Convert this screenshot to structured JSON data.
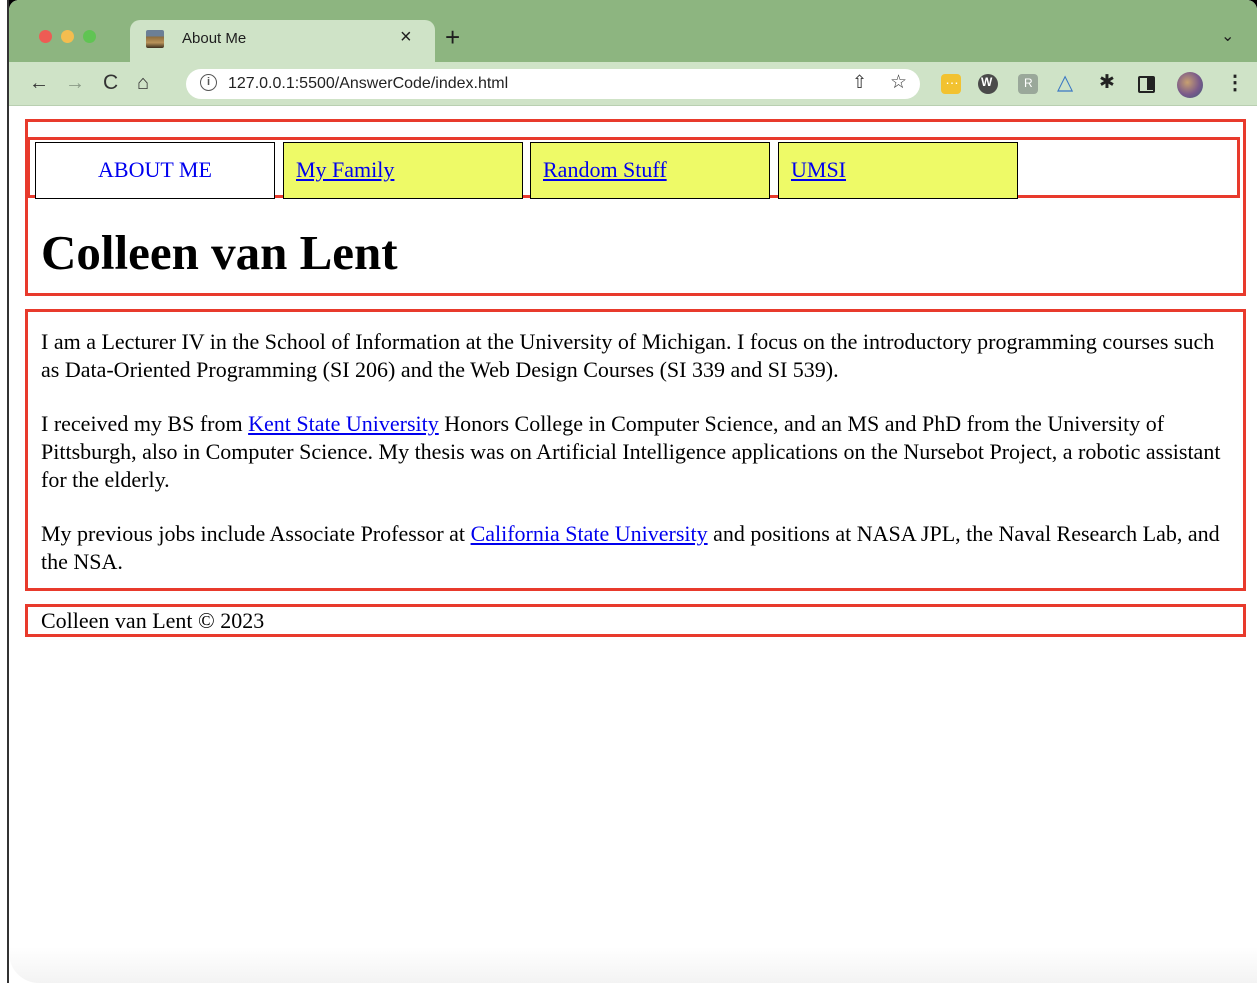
{
  "browser": {
    "tab": {
      "title": "About Me",
      "close": "×"
    },
    "new_tab": "+",
    "tab_menu": "⌄",
    "toolbar": {
      "back": "←",
      "forward": "→",
      "reload": "C",
      "home": "⌂",
      "info": "i",
      "url": "127.0.0.1:5500/AnswerCode/index.html",
      "share": "⇧",
      "bookmark": "☆",
      "menu": "⋮"
    },
    "extensions": [
      "extension-ellipsis-icon",
      "extension-w-icon",
      "extension-r-icon",
      "extension-triangle-icon",
      "puzzle-icon",
      "sidepanel-icon"
    ]
  },
  "page": {
    "nav": [
      {
        "label": "ABOUT ME",
        "active": true
      },
      {
        "label": "My Family",
        "active": false
      },
      {
        "label": "Random Stuff",
        "active": false
      },
      {
        "label": "UMSI",
        "active": false
      }
    ],
    "title": "Colleen van Lent",
    "paragraphs": {
      "p1": "I am a Lecturer IV in the School of Information at the University of Michigan. I focus on the introductory programming courses such as Data-Oriented Programming (SI 206) and the Web Design Courses (SI 339 and SI 539).",
      "p2_before": "I received my BS from ",
      "p2_link": "Kent State University",
      "p2_after": " Honors College in Computer Science, and an MS and PhD from the University of Pittsburgh, also in Computer Science. My thesis was on Artificial Intelligence applications on the Nursebot Project, a robotic assistant for the elderly.",
      "p3_before": "My previous jobs include Associate Professor at ",
      "p3_link": "California State University",
      "p3_after": " and positions at NASA JPL, the Naval Research Lab, and the NSA."
    },
    "footer": "Colleen van Lent © 2023"
  },
  "colors": {
    "box_border": "#e83a2c",
    "nav_link_bg": "#eefa67",
    "link": "#0000ee",
    "tabstrip": "#8db580",
    "toolbar": "#cfe3c7"
  }
}
